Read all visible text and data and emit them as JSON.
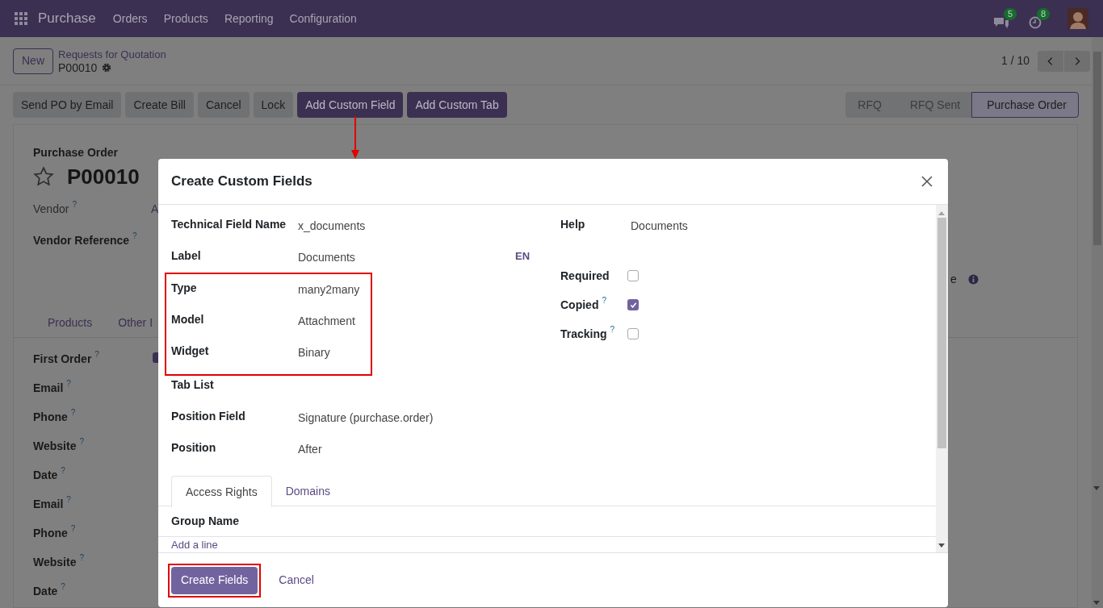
{
  "navbar": {
    "app": "Purchase",
    "menu": [
      "Orders",
      "Products",
      "Reporting",
      "Configuration"
    ],
    "messages_count": "5",
    "activities_count": "8"
  },
  "control_panel": {
    "new_button": "New",
    "breadcrumb": "Requests for Quotation",
    "record": "P00010",
    "pager": "1 / 10"
  },
  "actions": [
    {
      "label": "Send PO by Email",
      "kind": "secondary"
    },
    {
      "label": "Create Bill",
      "kind": "secondary"
    },
    {
      "label": "Cancel",
      "kind": "secondary"
    },
    {
      "label": "Lock",
      "kind": "secondary"
    },
    {
      "label": "Add Custom Field",
      "kind": "primary"
    },
    {
      "label": "Add Custom Tab",
      "kind": "primary"
    }
  ],
  "statusbar": [
    {
      "label": "RFQ",
      "selected": false
    },
    {
      "label": "RFQ Sent",
      "selected": false
    },
    {
      "label": "Purchase Order",
      "selected": true
    }
  ],
  "form": {
    "subtitle": "Purchase Order",
    "name": "P00010",
    "starred": false,
    "vendor": {
      "label": "Vendor",
      "hint": "?",
      "value": "A"
    },
    "vendor_reference": {
      "label": "Vendor Reference",
      "hint": "?"
    },
    "right_fragment": "e",
    "tabs": [
      {
        "label": "Products"
      },
      {
        "label": "Other I"
      }
    ],
    "fields": [
      {
        "label": "First Order",
        "hint": "?",
        "kind": "checkbox",
        "checked": true
      },
      {
        "label": "Email",
        "hint": "?",
        "kind": "text"
      },
      {
        "label": "Phone",
        "hint": "?",
        "kind": "text"
      },
      {
        "label": "Website",
        "hint": "?",
        "kind": "text"
      },
      {
        "label": "Date",
        "hint": "?",
        "kind": "text"
      },
      {
        "label": "Email",
        "hint": "?",
        "kind": "text"
      },
      {
        "label": "Phone",
        "hint": "?",
        "kind": "text"
      },
      {
        "label": "Website",
        "hint": "?",
        "kind": "text"
      },
      {
        "label": "Date",
        "hint": "?",
        "kind": "text"
      }
    ]
  },
  "dialog": {
    "title": "Create Custom Fields",
    "left_fields": [
      {
        "label": "Technical Field Name",
        "value": "x_documents",
        "highlighted": false
      },
      {
        "label": "Label",
        "value": "Documents",
        "translate": "EN",
        "highlighted": false
      },
      {
        "label": "Type",
        "value": "many2many",
        "highlighted": true
      },
      {
        "label": "Model",
        "value": "Attachment",
        "highlighted": true
      },
      {
        "label": "Widget",
        "value": "Binary",
        "highlighted": true
      },
      {
        "label": "Tab List",
        "highlighted": false
      },
      {
        "label": "Position Field",
        "value": "Signature (purchase.order)",
        "highlighted": false
      },
      {
        "label": "Position",
        "value": "After",
        "highlighted": false
      }
    ],
    "help": {
      "label": "Help",
      "value": "Documents"
    },
    "options": [
      {
        "label": "Required",
        "checked": false
      },
      {
        "label": "Copied",
        "hint": "?",
        "checked": true
      },
      {
        "label": "Tracking",
        "hint": "?",
        "checked": false
      }
    ],
    "tabs": [
      {
        "label": "Access Rights",
        "selected": true
      },
      {
        "label": "Domains",
        "selected": false
      }
    ],
    "table": {
      "columns": [
        "Group Name"
      ],
      "add_line": "Add a line"
    },
    "buttons": [
      {
        "label": "Create Fields",
        "kind": "primary",
        "highlighted": true
      },
      {
        "label": "Cancel",
        "kind": "link",
        "highlighted": false
      }
    ]
  }
}
